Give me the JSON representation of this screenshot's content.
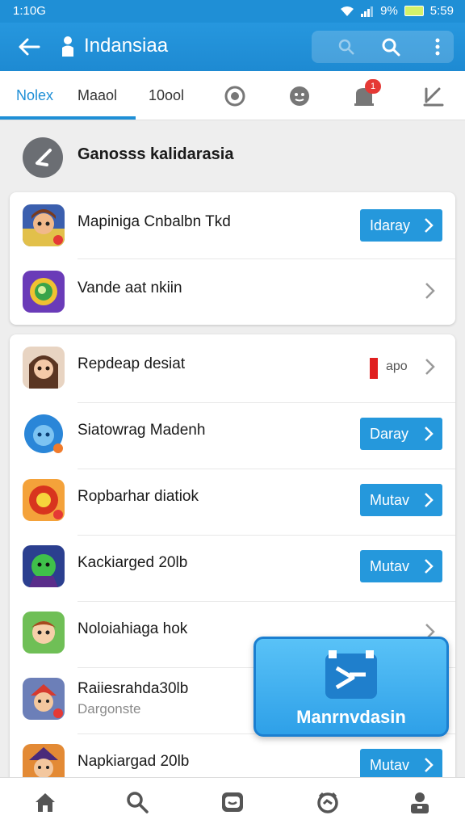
{
  "status_bar": {
    "time": "1:10G",
    "signal": "9%",
    "clock": "5:59"
  },
  "top_bar": {
    "title": "Indansiaa"
  },
  "tabs": [
    {
      "label": "Nolex",
      "active": true
    },
    {
      "label": "Maaol"
    },
    {
      "label": "10ool"
    }
  ],
  "tab_icons": [
    "camera-icon",
    "face-icon",
    "notification-icon",
    "edit-icon"
  ],
  "notification_badge": "1",
  "section": {
    "title": "Ganosss kalidarasia"
  },
  "group1": [
    {
      "name": "Mapiniga Cnbalbn Tkd",
      "icon": "game-warrior-icon",
      "action": "Idaray"
    },
    {
      "name": "Vande aat nkiin",
      "icon": "game-ring-icon"
    }
  ],
  "group2": [
    {
      "name": "Repdeap desiat",
      "icon": "game-girl-icon",
      "status": "apo",
      "status_color": "#e01f1f"
    },
    {
      "name": "Siatowrag Madenh",
      "icon": "game-blue-face-icon",
      "action": "Daray"
    },
    {
      "name": "Ropbarhar diatiok",
      "icon": "game-red-orb-icon",
      "action": "Mutav"
    },
    {
      "name": "Kackiarged 20lb",
      "icon": "game-green-hero-icon",
      "action": "Mutav"
    },
    {
      "name": "Noloiahiaga hok",
      "icon": "game-boy-icon"
    },
    {
      "name": "Raiiesrahda30lb",
      "sub": "Dargonste",
      "icon": "game-knight-icon"
    },
    {
      "name": "Napkiargad 20lb",
      "icon": "game-wizard-icon",
      "action": "Mutav"
    }
  ],
  "promo": {
    "label": "Manrnvdasin",
    "icon": "play-arrow-icon"
  },
  "bottom_nav": [
    "home-icon",
    "search-icon",
    "messages-icon",
    "timer-icon",
    "profile-icon"
  ],
  "colors": {
    "accent": "#1f8fd6",
    "button": "#2598dc",
    "background": "#eeeeee"
  }
}
